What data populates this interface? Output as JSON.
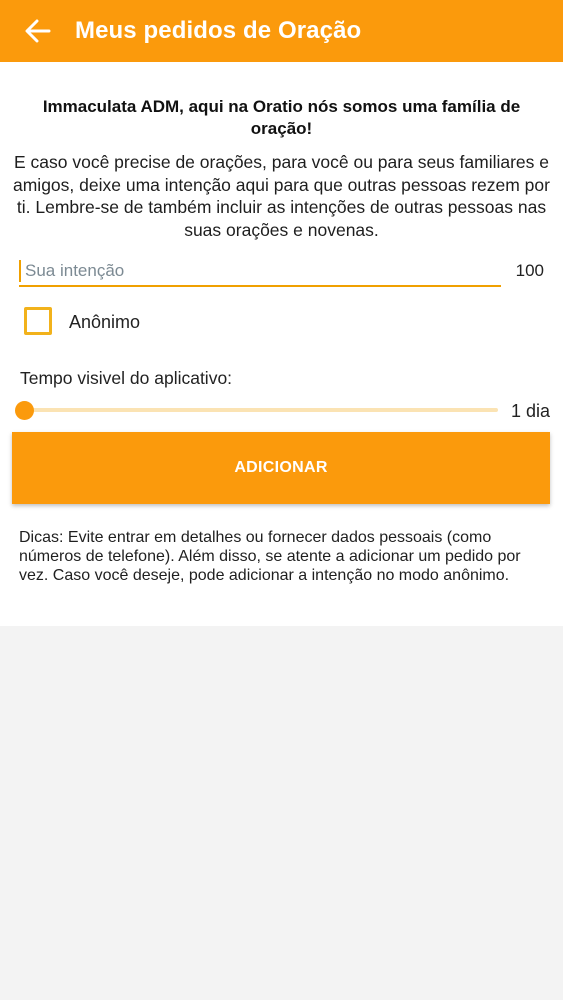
{
  "header": {
    "title": "Meus pedidos de Oração",
    "back_icon": "arrow-left-icon"
  },
  "main": {
    "greeting": "Immaculata ADM, aqui na Oratio nós somos uma família de oração!",
    "intro": "E caso você precise de orações, para você ou para seus familiares e amigos, deixe uma intenção aqui para que outras pessoas rezem por ti. Lembre-se de também incluir as intenções de outras pessoas nas suas orações e novenas.",
    "intention": {
      "placeholder": "Sua intenção",
      "value": "",
      "counter": "100"
    },
    "anonymous": {
      "label": "Anônimo",
      "checked": false
    },
    "visibility": {
      "label": "Tempo visivel do aplicativo:",
      "value_label": "1 dia",
      "fraction": 0
    },
    "add_button_label": "ADICIONAR",
    "tips": "Dicas: Evite entrar em detalhes ou fornecer dados pessoais (como números de telefone). Além disso, se atente a adicionar um pedido por vez. Caso você deseje, pode adicionar a intenção no modo anônimo."
  },
  "colors": {
    "accent": "#fb9a0c",
    "checkbox_border": "#f2b21b",
    "track": "#fbe3b3",
    "background": "#f3f3f3"
  }
}
